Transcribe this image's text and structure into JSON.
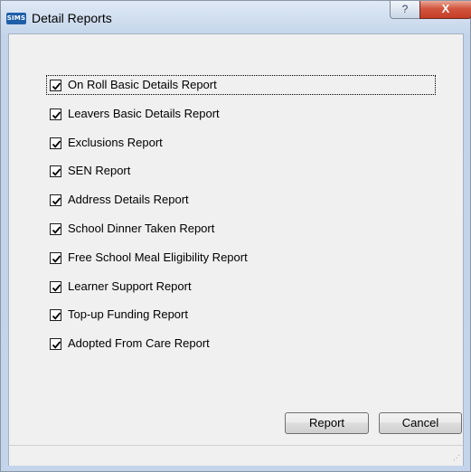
{
  "window": {
    "app_icon": "SIMS",
    "title": "Detail Reports",
    "help_icon": "question-icon",
    "close_icon": "close-icon",
    "help_label": "?",
    "close_label": "X"
  },
  "reports": [
    {
      "label": "On Roll Basic Details Report",
      "checked": true
    },
    {
      "label": "Leavers Basic Details Report",
      "checked": true
    },
    {
      "label": "Exclusions Report",
      "checked": true
    },
    {
      "label": "SEN Report",
      "checked": true
    },
    {
      "label": "Address Details Report",
      "checked": true
    },
    {
      "label": "School Dinner Taken Report",
      "checked": true
    },
    {
      "label": "Free School Meal Eligibility Report",
      "checked": true
    },
    {
      "label": "Learner Support Report",
      "checked": true
    },
    {
      "label": "Top-up Funding Report",
      "checked": true
    },
    {
      "label": "Adopted From Care Report",
      "checked": true
    }
  ],
  "buttons": {
    "report_label": "Report",
    "cancel_label": "Cancel"
  }
}
